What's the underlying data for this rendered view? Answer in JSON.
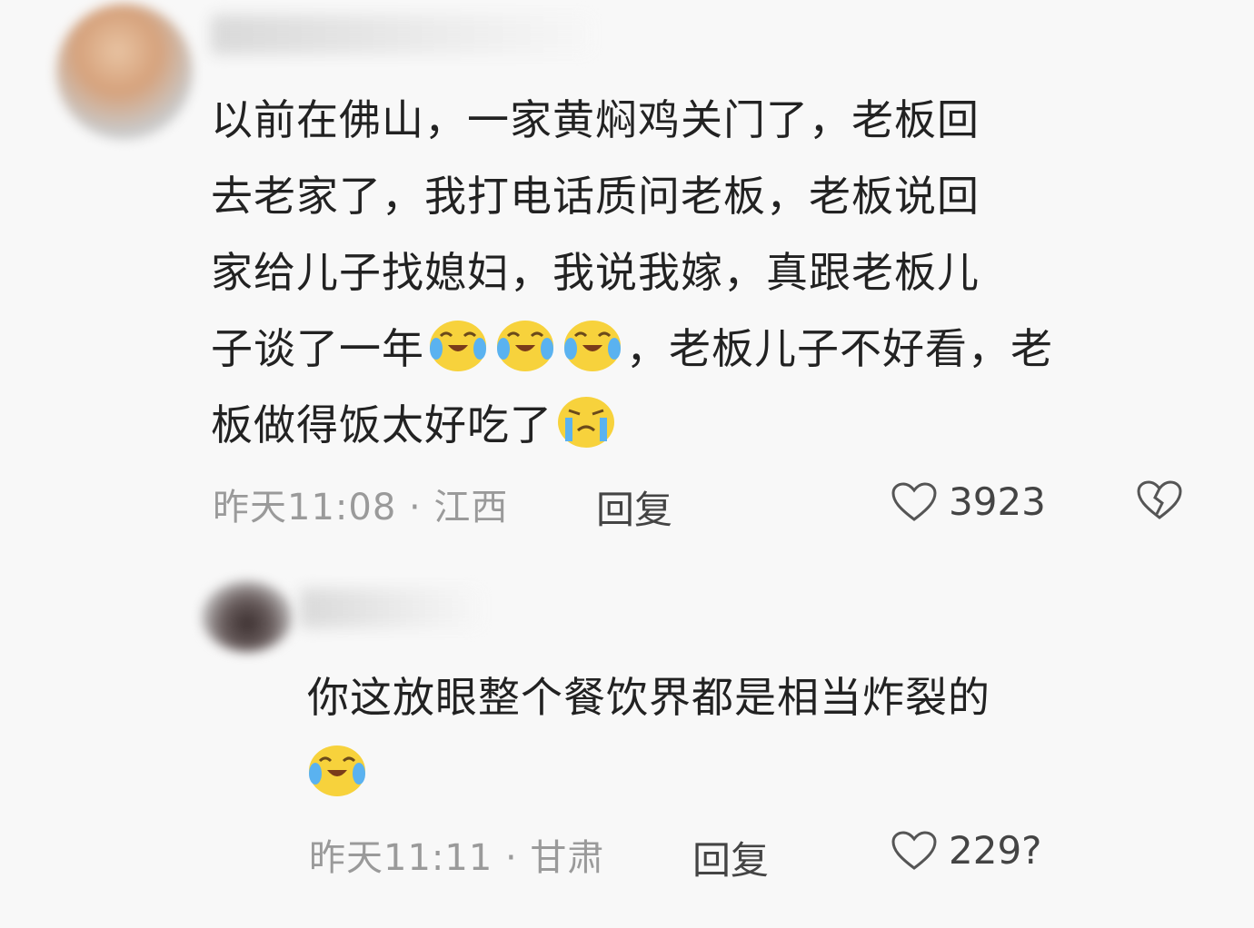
{
  "comments": [
    {
      "lines": [
        "以前在佛山，一家黄焖鸡关门了，老板回",
        "去老家了，我打电话质问老板，老板说回",
        "家给儿子找媳妇，我说我嫁，真跟老板儿"
      ],
      "line4_prefix": "子谈了一年",
      "line4_suffix": "，老板儿子不好看，老",
      "line5_prefix": "板做得饭太好吃了",
      "time_location": "昨天11:08 · 江西",
      "reply_label": "回复",
      "likes": "3923",
      "emojis": [
        "laugh-cry-icon",
        "laugh-cry-icon",
        "laugh-cry-icon",
        "crying-icon"
      ]
    },
    {
      "line1": "你这放眼整个餐饮界都是相当炸裂的",
      "time_location": "昨天11:11 · 甘肃",
      "reply_label": "回复",
      "likes": "229?",
      "emojis": [
        "laugh-cry-icon"
      ]
    }
  ],
  "colors": {
    "text": "#222222",
    "meta": "#9a9a9a",
    "emoji_face": "#f7d23c",
    "tear": "#5ab2f0"
  }
}
